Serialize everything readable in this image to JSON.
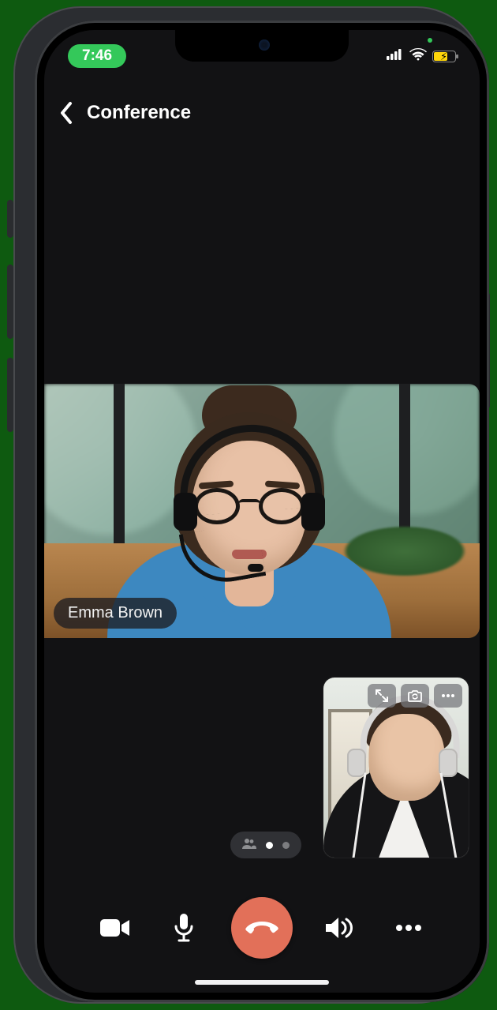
{
  "status": {
    "time": "7:46",
    "privacy_indicator": "camera-active",
    "cellular_bars": 4,
    "wifi": true,
    "battery_pct": 60,
    "battery_charging": true
  },
  "header": {
    "back_icon": "chevron-left-icon",
    "title": "Conference"
  },
  "main_video": {
    "participant_name": "Emma Brown"
  },
  "self_view": {
    "controls": {
      "expand_icon": "expand-icon",
      "switch_camera_icon": "switch-camera-icon",
      "more_icon": "more-horizontal-icon"
    }
  },
  "pager": {
    "participants_icon": "participants-icon",
    "active_index": 0,
    "total": 2
  },
  "toolbar": {
    "video_icon": "video-icon",
    "mic_icon": "mic-icon",
    "hangup_icon": "hangup-icon",
    "speaker_icon": "speaker-icon",
    "more_icon": "more-horizontal-icon"
  },
  "colors": {
    "hangup": "#e27059",
    "time_pill": "#34c85a",
    "battery_fill": "#ffd60a"
  }
}
